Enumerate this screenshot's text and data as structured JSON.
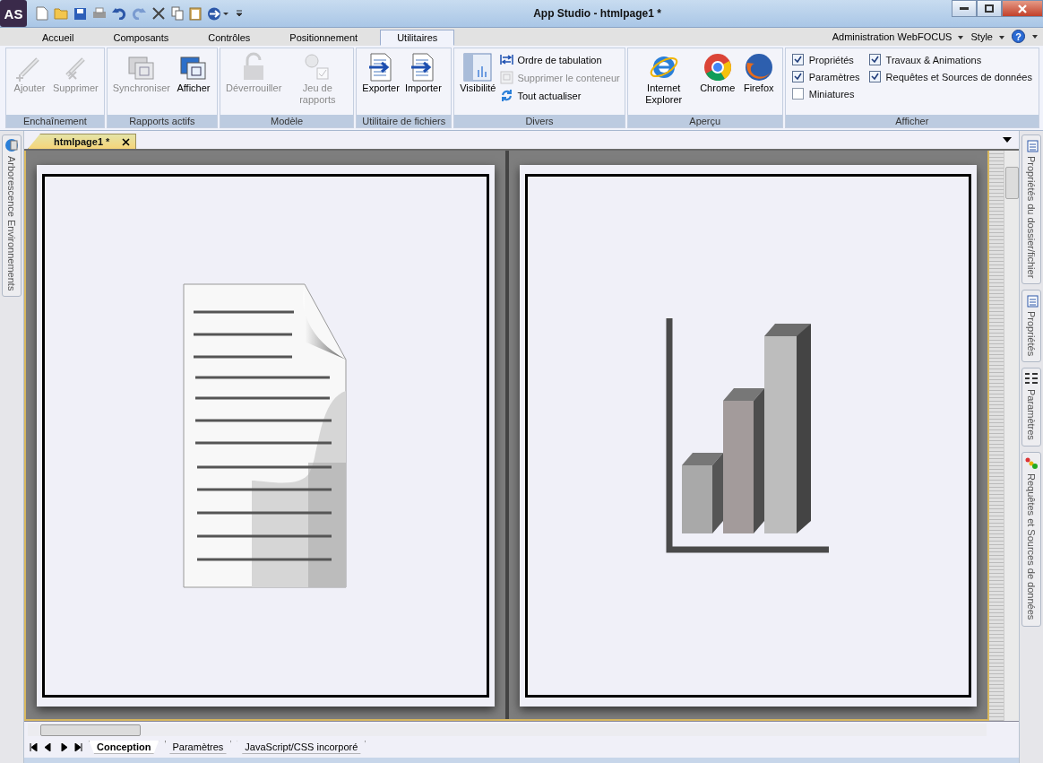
{
  "window": {
    "title": "App Studio - htmlpage1 *",
    "logo": "AS"
  },
  "ribbon_tabs": [
    {
      "label": "Accueil",
      "selected": false
    },
    {
      "label": "Composants",
      "selected": false
    },
    {
      "label": "Contrôles",
      "selected": false
    },
    {
      "label": "Positionnement",
      "selected": false
    },
    {
      "label": "Utilitaires",
      "selected": true
    }
  ],
  "ribbon_menus": [
    {
      "label": "Administration WebFOCUS"
    },
    {
      "label": "Style"
    }
  ],
  "help_button": {
    "label": "?"
  },
  "ribbon_groups": [
    {
      "title": "Enchaînement",
      "items": [
        {
          "kind": "large",
          "label": "Ajouter",
          "disabled": true
        },
        {
          "kind": "large",
          "label": "Supprimer",
          "disabled": true
        }
      ]
    },
    {
      "title": "Rapports actifs",
      "items": [
        {
          "kind": "large",
          "label": "Synchroniser",
          "disabled": true
        },
        {
          "kind": "large",
          "label": "Afficher",
          "disabled": false
        }
      ]
    },
    {
      "title": "Modèle",
      "items": [
        {
          "kind": "large",
          "label": "Déverrouiller",
          "disabled": true
        },
        {
          "kind": "large",
          "label": "Jeu de rapports",
          "disabled": true
        }
      ]
    },
    {
      "title": "Utilitaire de fichiers",
      "items": [
        {
          "kind": "large",
          "label": "Exporter",
          "disabled": false
        },
        {
          "kind": "large",
          "label": "Importer",
          "disabled": false
        }
      ]
    },
    {
      "title": "Divers",
      "items": [
        {
          "kind": "large",
          "label": "Visibilité",
          "disabled": false
        },
        {
          "kind": "small",
          "label": "Ordre de tabulation",
          "disabled": false
        },
        {
          "kind": "small",
          "label": "Supprimer le conteneur",
          "disabled": true
        },
        {
          "kind": "small",
          "label": "Tout actualiser",
          "disabled": false
        }
      ]
    },
    {
      "title": "Aperçu",
      "items": [
        {
          "kind": "large",
          "label": "Internet Explorer",
          "disabled": false
        },
        {
          "kind": "large",
          "label": "Chrome",
          "disabled": false
        },
        {
          "kind": "large",
          "label": "Firefox",
          "disabled": false
        }
      ]
    },
    {
      "title": "Afficher",
      "items": [
        {
          "kind": "checkbox",
          "label": "Propriétés",
          "checked": true
        },
        {
          "kind": "checkbox",
          "label": "Travaux & Animations",
          "checked": true
        },
        {
          "kind": "checkbox",
          "label": "Paramètres",
          "checked": true
        },
        {
          "kind": "checkbox",
          "label": "Requêtes et Sources de données",
          "checked": true
        },
        {
          "kind": "checkbox",
          "label": "Miniatures",
          "checked": false
        }
      ]
    }
  ],
  "left_panels": [
    {
      "label": "Arborescence Environnements"
    }
  ],
  "document_tabs": [
    {
      "label": "htmlpage1 *",
      "selected": true
    }
  ],
  "right_panels": [
    {
      "label": "Propriétés du dossier/fichier"
    },
    {
      "label": "Propriétés"
    },
    {
      "label": "Paramètres"
    },
    {
      "label": "Requêtes et Sources de données"
    }
  ],
  "bottom_tabs": [
    {
      "label": "Conception",
      "selected": true
    },
    {
      "label": "Paramètres",
      "selected": false
    },
    {
      "label": "JavaScript/CSS incorporé",
      "selected": false
    }
  ]
}
